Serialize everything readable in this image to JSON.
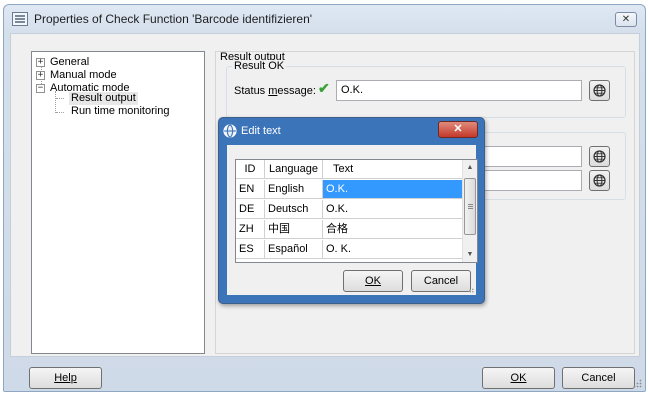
{
  "window": {
    "title": "Properties of Check Function 'Barcode identifizieren'",
    "close_glyph": "✕"
  },
  "tree": {
    "items": [
      {
        "label": "General",
        "expander": "+"
      },
      {
        "label": "Manual mode",
        "expander": "+"
      },
      {
        "label": "Automatic mode",
        "expander": "−"
      },
      {
        "label": "Result output",
        "selected": true
      },
      {
        "label": "Run time monitoring"
      }
    ]
  },
  "panel": {
    "section_label": "Result output",
    "group_label": "Result OK",
    "status_label_pre": "Status ",
    "status_label_mnemonic": "m",
    "status_label_post": "essage:",
    "status_value": "O.K.",
    "second_group_field1": "",
    "second_group_field2": ""
  },
  "footer": {
    "help_label": "Help",
    "ok_label": "OK",
    "cancel_label": "Cancel"
  },
  "popup": {
    "title": "Edit text",
    "close_glyph": "✕",
    "columns": [
      "ID",
      "Language",
      "Text"
    ],
    "rows": [
      {
        "id": "EN",
        "language": "English",
        "text": "O.K.",
        "selected": true
      },
      {
        "id": "DE",
        "language": "Deutsch",
        "text": "O.K."
      },
      {
        "id": "ZH",
        "language": "中国",
        "text": "合格"
      },
      {
        "id": "ES",
        "language": "Español",
        "text": "O. K."
      }
    ],
    "ok_label": "OK",
    "cancel_label": "Cancel"
  },
  "icons": {
    "window": "properties-window-icon",
    "globe": "globe-icon",
    "check": "checkmark-icon"
  },
  "colors": {
    "selection": "#3399ff",
    "popup_frame": "#3c74ba",
    "check": "#3aa23a"
  }
}
